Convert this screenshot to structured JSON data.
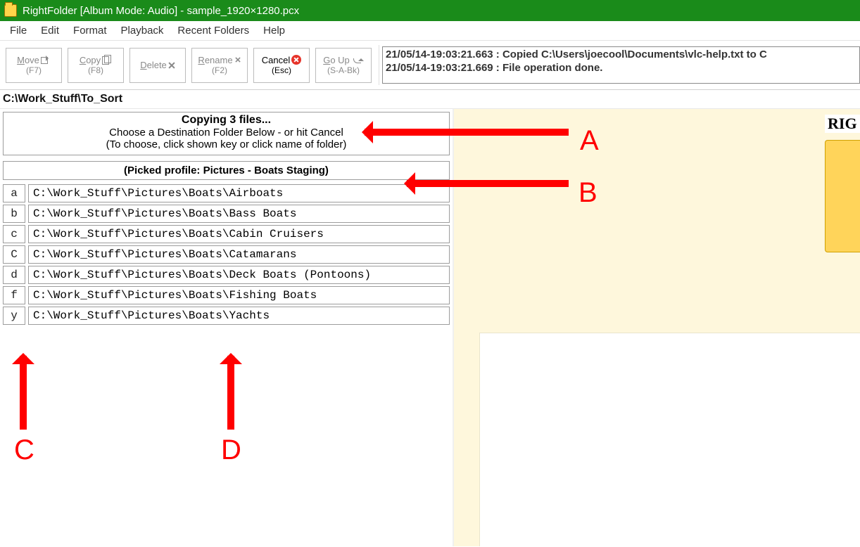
{
  "window": {
    "title": "RightFolder [Album Mode: Audio] - sample_1920×1280.pcx"
  },
  "menu": {
    "items": [
      "File",
      "Edit",
      "Format",
      "Playback",
      "Recent Folders",
      "Help"
    ]
  },
  "toolbar": {
    "move": {
      "label": "Move",
      "key": "(F7)"
    },
    "copy": {
      "label": "Copy",
      "key": "(F8)"
    },
    "delete": {
      "label": "Delete"
    },
    "rename": {
      "label": "Rename",
      "key": "(F2)"
    },
    "cancel": {
      "label": "Cancel",
      "key": "(Esc)"
    },
    "goup": {
      "label": "Go Up",
      "key": "(S-A-Bk)"
    }
  },
  "log": {
    "line1": "21/05/14-19:03:21.663 : Copied C:\\Users\\joecool\\Documents\\vlc-help.txt to C",
    "line2": "21/05/14-19:03:21.669 : File operation done."
  },
  "current_path": "C:\\Work_Stuff\\To_Sort",
  "status": {
    "header": "Copying 3 files...",
    "line2": "Choose a Destination Folder Below - or hit Cancel",
    "line3": "(To choose, click shown key or click name of folder)"
  },
  "profile_line": "(Picked profile: Pictures - Boats Staging)",
  "folders": [
    {
      "key": "a",
      "path": "C:\\Work_Stuff\\Pictures\\Boats\\Airboats"
    },
    {
      "key": "b",
      "path": "C:\\Work_Stuff\\Pictures\\Boats\\Bass Boats"
    },
    {
      "key": "c",
      "path": "C:\\Work_Stuff\\Pictures\\Boats\\Cabin Cruisers"
    },
    {
      "key": "C",
      "path": "C:\\Work_Stuff\\Pictures\\Boats\\Catamarans"
    },
    {
      "key": "d",
      "path": "C:\\Work_Stuff\\Pictures\\Boats\\Deck Boats (Pontoons)"
    },
    {
      "key": "f",
      "path": "C:\\Work_Stuff\\Pictures\\Boats\\Fishing Boats"
    },
    {
      "key": "y",
      "path": "C:\\Work_Stuff\\Pictures\\Boats\\Yachts"
    }
  ],
  "right_pane": {
    "partial_text": "RIG"
  },
  "annotations": {
    "A": "A",
    "B": "B",
    "C": "C",
    "D": "D"
  }
}
